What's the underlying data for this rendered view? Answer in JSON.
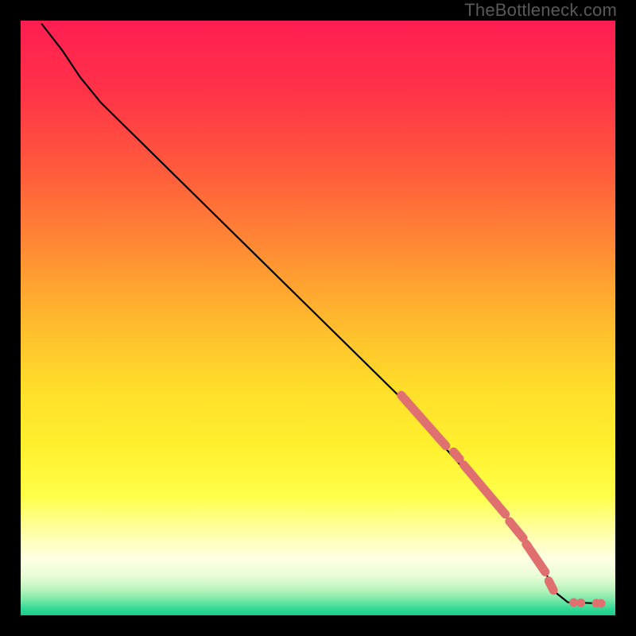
{
  "watermark": "TheBottleneck.com",
  "colors": {
    "bg_black": "#000000",
    "curve": "#000000",
    "marker_fill": "#E07070",
    "gradient_stops": [
      {
        "offset": 0.0,
        "color": "#FF1E52"
      },
      {
        "offset": 0.12,
        "color": "#FF3348"
      },
      {
        "offset": 0.25,
        "color": "#FF5A3C"
      },
      {
        "offset": 0.38,
        "color": "#FF8A34"
      },
      {
        "offset": 0.5,
        "color": "#FFB82E"
      },
      {
        "offset": 0.62,
        "color": "#FFDE2A"
      },
      {
        "offset": 0.72,
        "color": "#FFF12F"
      },
      {
        "offset": 0.8,
        "color": "#FFFF4A"
      },
      {
        "offset": 0.86,
        "color": "#FFFFA8"
      },
      {
        "offset": 0.905,
        "color": "#FFFFE4"
      },
      {
        "offset": 0.935,
        "color": "#E7FCD6"
      },
      {
        "offset": 0.958,
        "color": "#B6F3BC"
      },
      {
        "offset": 0.975,
        "color": "#74E6A6"
      },
      {
        "offset": 0.989,
        "color": "#32D994"
      },
      {
        "offset": 1.0,
        "color": "#18CC88"
      }
    ]
  },
  "chart_data": {
    "type": "line",
    "title": "",
    "xlabel": "",
    "ylabel": "",
    "xlim": [
      0,
      100
    ],
    "ylim": [
      0,
      100
    ],
    "curve": [
      {
        "x": 3.5,
        "y": 99.5
      },
      {
        "x": 7.0,
        "y": 95.0
      },
      {
        "x": 10.0,
        "y": 90.5
      },
      {
        "x": 13.5,
        "y": 86.2
      },
      {
        "x": 63.5,
        "y": 37.0
      },
      {
        "x": 84.0,
        "y": 14.0
      },
      {
        "x": 88.0,
        "y": 8.0
      },
      {
        "x": 89.5,
        "y": 4.2
      },
      {
        "x": 92.0,
        "y": 2.2
      },
      {
        "x": 97.5,
        "y": 2.0
      }
    ],
    "marker_segments": [
      {
        "x1": 64.0,
        "y1": 37.0,
        "x2": 71.5,
        "y2": 28.5
      },
      {
        "x1": 72.8,
        "y1": 27.5,
        "x2": 73.8,
        "y2": 26.3
      },
      {
        "x1": 74.5,
        "y1": 25.3,
        "x2": 81.5,
        "y2": 17.0
      },
      {
        "x1": 82.2,
        "y1": 15.8,
        "x2": 84.5,
        "y2": 13.0
      },
      {
        "x1": 85.0,
        "y1": 12.0,
        "x2": 88.2,
        "y2": 7.3
      },
      {
        "x1": 88.8,
        "y1": 5.8,
        "x2": 89.6,
        "y2": 4.2
      }
    ],
    "marker_points": [
      {
        "x": 93.0,
        "y": 2.15
      },
      {
        "x": 94.2,
        "y": 2.1
      },
      {
        "x": 96.8,
        "y": 2.02
      },
      {
        "x": 97.6,
        "y": 2.0
      }
    ]
  }
}
